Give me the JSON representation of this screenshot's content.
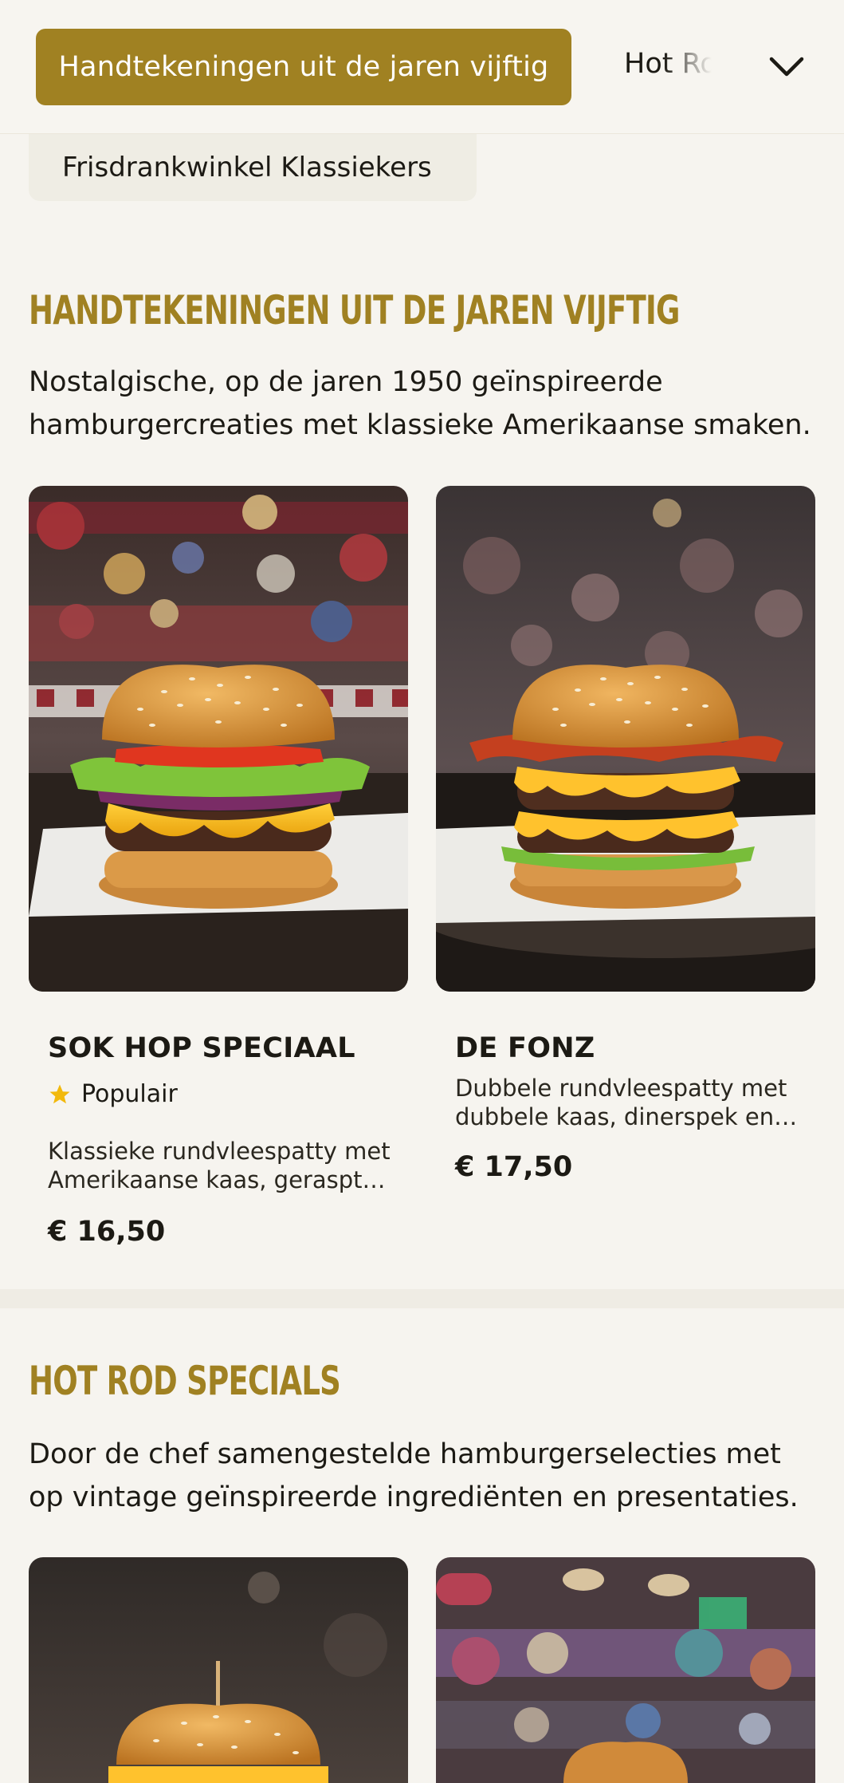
{
  "category_nav": {
    "active_label": "Handtekeningen uit de jaren vijftig",
    "next_label": "Hot Rod Specials",
    "overflow_label": "Frisdrankwinkel Klassiekers",
    "expand_icon": "chevron-down-icon"
  },
  "sections": [
    {
      "title": "Handtekeningen uit de jaren vijftig",
      "description": "Nostalgische, op de jaren 1950 geïnspireerde hamburgercreaties met klassieke Amerikaanse smaken.",
      "items": [
        {
          "name": "SOK HOP SPECIAAL",
          "badge": "Populair",
          "badge_icon": "star-icon",
          "description": "Klassieke rundvleespatty met Amerikaanse kaas, geraspte sla, tomaat en rode ui.",
          "price": "€ 16,50"
        },
        {
          "name": "DE FONZ",
          "description": "Dubbele rundvleespatty met dubbele kaas, dinerspek en sla.",
          "price": "€ 17,50"
        }
      ]
    },
    {
      "title": "Hot Rod Specials",
      "description": "Door de chef samengestelde hamburgerselecties met op vintage geïnspireerde ingrediënten en presentaties."
    }
  ],
  "colors": {
    "accent": "#a08122",
    "background": "#f6f4ef",
    "star": "#f2b90c"
  }
}
